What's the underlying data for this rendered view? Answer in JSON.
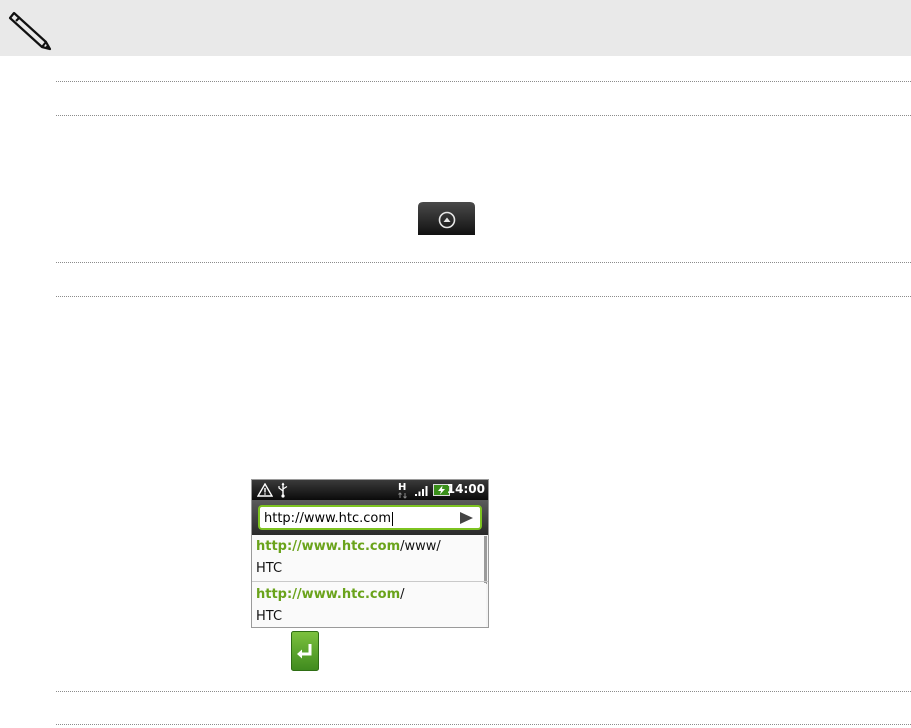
{
  "note": {
    "icon": "pencil-icon"
  },
  "home_key": {
    "icon": "home-up-arrow-icon"
  },
  "phone": {
    "status_bar": {
      "icons": [
        "warning-icon",
        "usb-icon",
        "hspa-data-icon",
        "signal-icon",
        "battery-charging-icon"
      ],
      "time": "14:00"
    },
    "url_bar": {
      "value": "http://www.htc.com",
      "go_icon": "play-arrow-icon"
    },
    "suggestions": [
      {
        "url_highlight": "http://www.htc.com",
        "url_rest": "/www/",
        "title": "HTC"
      },
      {
        "url_highlight": "http://www.htc.com",
        "url_rest": "/",
        "title": "HTC"
      }
    ]
  },
  "enter_key": {
    "icon": "enter-return-icon",
    "color": "#5aa02c"
  },
  "colors": {
    "accent": "#7dc320",
    "highlight": "#6aa31b",
    "note_bg": "#e9e9e9"
  }
}
